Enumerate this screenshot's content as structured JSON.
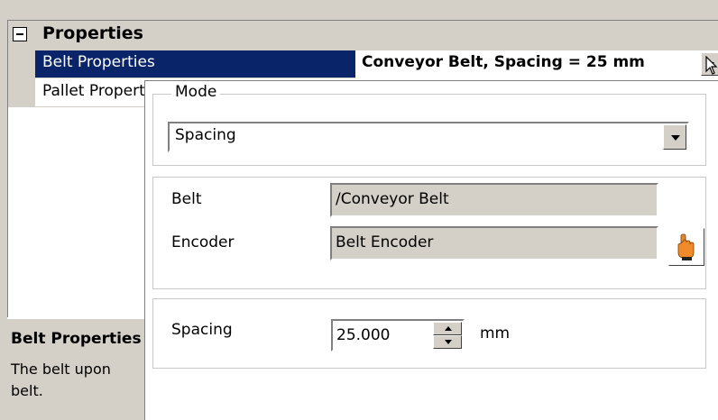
{
  "grid": {
    "category": "Properties",
    "rows": [
      {
        "name": "Belt Properties",
        "value": "Conveyor Belt, Spacing = 25 mm"
      },
      {
        "name": "Pallet Properties",
        "value": ""
      }
    ]
  },
  "description": {
    "title": "Belt Properties",
    "text": "The belt upon belt."
  },
  "popup": {
    "mode": {
      "title": "Mode",
      "selected": "Spacing"
    },
    "belt": {
      "label": "Belt",
      "value": "/Conveyor Belt"
    },
    "encoder": {
      "label": "Encoder",
      "value": "Belt Encoder"
    },
    "spacing": {
      "label": "Spacing",
      "value": "25.000",
      "unit": "mm"
    }
  },
  "icons": {
    "expander": "minus-box-icon",
    "dropdown": "chevron-down-icon",
    "picker": "hand-pointer-icon",
    "cursor": "mouse-pointer-icon"
  },
  "colors": {
    "selection": "#0a246a",
    "chrome": "#d4d0c8"
  }
}
